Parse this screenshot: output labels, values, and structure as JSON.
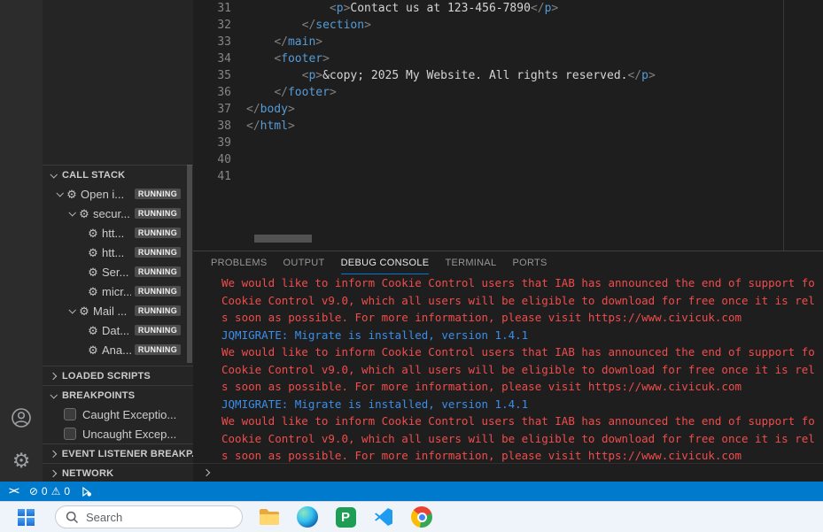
{
  "colors": {
    "statusbar_bg": "#007acc",
    "console_error": "#f14c4c",
    "console_info": "#3b8eea",
    "tag_blue": "#569cd6",
    "punctuation_gray": "#808080",
    "active_tab_underline": "#0078d4",
    "running_badge_bg": "#4d4d4d"
  },
  "icons": {
    "gear": "⚙",
    "settings_gear": "⚙",
    "error": "⊘",
    "warning": "⚠",
    "remote": "><"
  },
  "sidebar": {
    "sections": [
      {
        "label": "CALL STACK",
        "expanded": true
      },
      {
        "label": "LOADED SCRIPTS",
        "expanded": false
      },
      {
        "label": "BREAKPOINTS",
        "expanded": true
      },
      {
        "label": "EVENT LISTENER BREAKP...",
        "expanded": false
      },
      {
        "label": "NETWORK",
        "expanded": false
      }
    ],
    "call_stack": [
      {
        "label": "Open i...",
        "badge": "RUNNING",
        "level": 1,
        "expandable": true
      },
      {
        "label": "secur...",
        "badge": "RUNNING",
        "level": 2,
        "expandable": true
      },
      {
        "label": "htt...",
        "badge": "RUNNING",
        "level": 3,
        "expandable": false
      },
      {
        "label": "htt...",
        "badge": "RUNNING",
        "level": 3,
        "expandable": false
      },
      {
        "label": "Ser...",
        "badge": "RUNNING",
        "level": 3,
        "expandable": false
      },
      {
        "label": "micr...",
        "badge": "RUNNING",
        "level": 3,
        "expandable": false
      },
      {
        "label": "Mail ...",
        "badge": "RUNNING",
        "level": 2,
        "expandable": true
      },
      {
        "label": "Dat...",
        "badge": "RUNNING",
        "level": 3,
        "expandable": false
      },
      {
        "label": "Ana...",
        "badge": "RUNNING",
        "level": 3,
        "expandable": false
      }
    ],
    "breakpoints": [
      {
        "label": "Caught Exceptio...",
        "checked": false
      },
      {
        "label": "Uncaught Excep...",
        "checked": false
      }
    ]
  },
  "editor": {
    "code_lines": [
      {
        "num": "31",
        "indent": 12,
        "segments": [
          [
            "<",
            "p"
          ],
          [
            "p",
            "t"
          ],
          [
            ">",
            "p"
          ],
          [
            "Contact us at 123-456-7890",
            "x"
          ],
          [
            "</",
            "p"
          ],
          [
            "p",
            "t"
          ],
          [
            ">",
            "p"
          ]
        ]
      },
      {
        "num": "32",
        "indent": 8,
        "segments": [
          [
            "</",
            "p"
          ],
          [
            "section",
            "t"
          ],
          [
            ">",
            "p"
          ]
        ]
      },
      {
        "num": "33",
        "indent": 4,
        "segments": [
          [
            "</",
            "p"
          ],
          [
            "main",
            "t"
          ],
          [
            ">",
            "p"
          ]
        ]
      },
      {
        "num": "34",
        "indent": 4,
        "segments": [
          [
            "<",
            "p"
          ],
          [
            "footer",
            "t"
          ],
          [
            ">",
            "p"
          ]
        ]
      },
      {
        "num": "35",
        "indent": 8,
        "segments": [
          [
            "<",
            "p"
          ],
          [
            "p",
            "t"
          ],
          [
            ">",
            "p"
          ],
          [
            "&copy; 2025 My Website. All rights reserved.",
            "x"
          ],
          [
            "</",
            "p"
          ],
          [
            "p",
            "t"
          ],
          [
            ">",
            "p"
          ]
        ]
      },
      {
        "num": "36",
        "indent": 4,
        "segments": [
          [
            "</",
            "p"
          ],
          [
            "footer",
            "t"
          ],
          [
            ">",
            "p"
          ]
        ]
      },
      {
        "num": "37",
        "indent": 0,
        "segments": [
          [
            "</",
            "p"
          ],
          [
            "body",
            "t"
          ],
          [
            ">",
            "p"
          ]
        ]
      },
      {
        "num": "38",
        "indent": 0,
        "segments": [
          [
            "</",
            "p"
          ],
          [
            "html",
            "t"
          ],
          [
            ">",
            "p"
          ]
        ]
      },
      {
        "num": "39",
        "indent": 0,
        "segments": []
      },
      {
        "num": "40",
        "indent": 0,
        "segments": []
      },
      {
        "num": "41",
        "indent": 0,
        "segments": []
      }
    ]
  },
  "panel": {
    "tabs": [
      {
        "label": "PROBLEMS",
        "active": false
      },
      {
        "label": "OUTPUT",
        "active": false
      },
      {
        "label": "DEBUG CONSOLE",
        "active": true
      },
      {
        "label": "TERMINAL",
        "active": false
      },
      {
        "label": "PORTS",
        "active": false
      }
    ],
    "console_lines": [
      {
        "kind": "error",
        "text": "We would like to inform Cookie Control users that IAB has announced the end of support fo"
      },
      {
        "kind": "error",
        "text": "Cookie Control v9.0, which all users will be eligible to download for free once it is rel"
      },
      {
        "kind": "error",
        "text": "s soon as possible. For more information, please visit https://www.civicuk.com"
      },
      {
        "kind": "info",
        "text": "JQMIGRATE: Migrate is installed, version 1.4.1"
      },
      {
        "kind": "error",
        "text": "We would like to inform Cookie Control users that IAB has announced the end of support fo"
      },
      {
        "kind": "error",
        "text": "Cookie Control v9.0, which all users will be eligible to download for free once it is rel"
      },
      {
        "kind": "error",
        "text": "s soon as possible. For more information, please visit https://www.civicuk.com"
      },
      {
        "kind": "info",
        "text": "JQMIGRATE: Migrate is installed, version 1.4.1"
      },
      {
        "kind": "error",
        "text": "We would like to inform Cookie Control users that IAB has announced the end of support fo"
      },
      {
        "kind": "error",
        "text": "Cookie Control v9.0, which all users will be eligible to download for free once it is rel"
      },
      {
        "kind": "error",
        "text": "s soon as possible. For more information, please visit https://www.civicuk.com"
      }
    ]
  },
  "statusbar": {
    "errors": "0",
    "warnings": "0"
  },
  "taskbar": {
    "search_label": "Search",
    "app_p_label": "P"
  }
}
